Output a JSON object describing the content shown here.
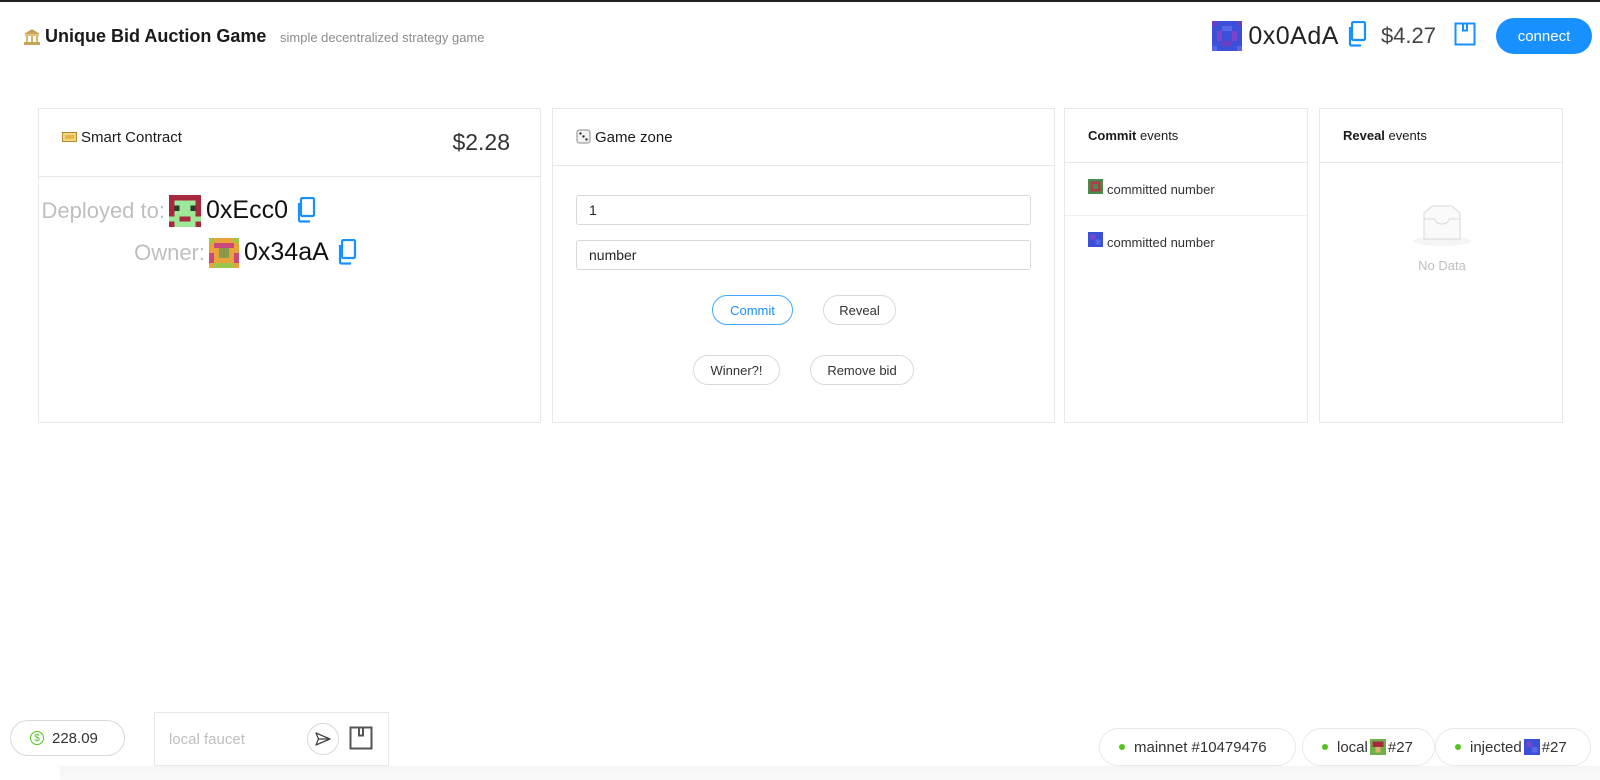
{
  "header": {
    "title": "Unique Bid Auction Game",
    "subtitle": "simple decentralized strategy game",
    "account": {
      "address": "0x0AdA",
      "balance": "$4.27"
    },
    "connect_label": "connect"
  },
  "contract_card": {
    "title": "Smart Contract",
    "balance": "$2.28",
    "deployed_label": "Deployed to:",
    "deployed_address": "0xEcc0",
    "owner_label": "Owner:",
    "owner_address": "0x34aA"
  },
  "game_zone": {
    "title": "Game zone",
    "input1_value": "1",
    "input2_placeholder": "number",
    "buttons": {
      "commit": "Commit",
      "reveal": "Reveal",
      "winner": "Winner?!",
      "remove": "Remove bid"
    }
  },
  "commit_events": {
    "title_bold": "Commit",
    "title_rest": " events",
    "items": [
      {
        "text": "committed number"
      },
      {
        "text": "committed number"
      }
    ]
  },
  "reveal_events": {
    "title_bold": "Reveal",
    "title_rest": " events",
    "empty_text": "No Data"
  },
  "footer": {
    "balance": "228.09",
    "faucet_placeholder": "local faucet",
    "networks": [
      {
        "name": "mainnet #10479476"
      },
      {
        "name": "local",
        "suffix": "#27"
      },
      {
        "name": "injected",
        "suffix": "#27"
      }
    ]
  },
  "colors": {
    "accent": "#1890ff",
    "status_green": "#52c41a"
  },
  "icons": [
    "bank-icon",
    "ticket-icon",
    "dice-icon",
    "copy-icon",
    "wallet-icon",
    "send-icon",
    "dollar-icon",
    "inbox-icon"
  ]
}
